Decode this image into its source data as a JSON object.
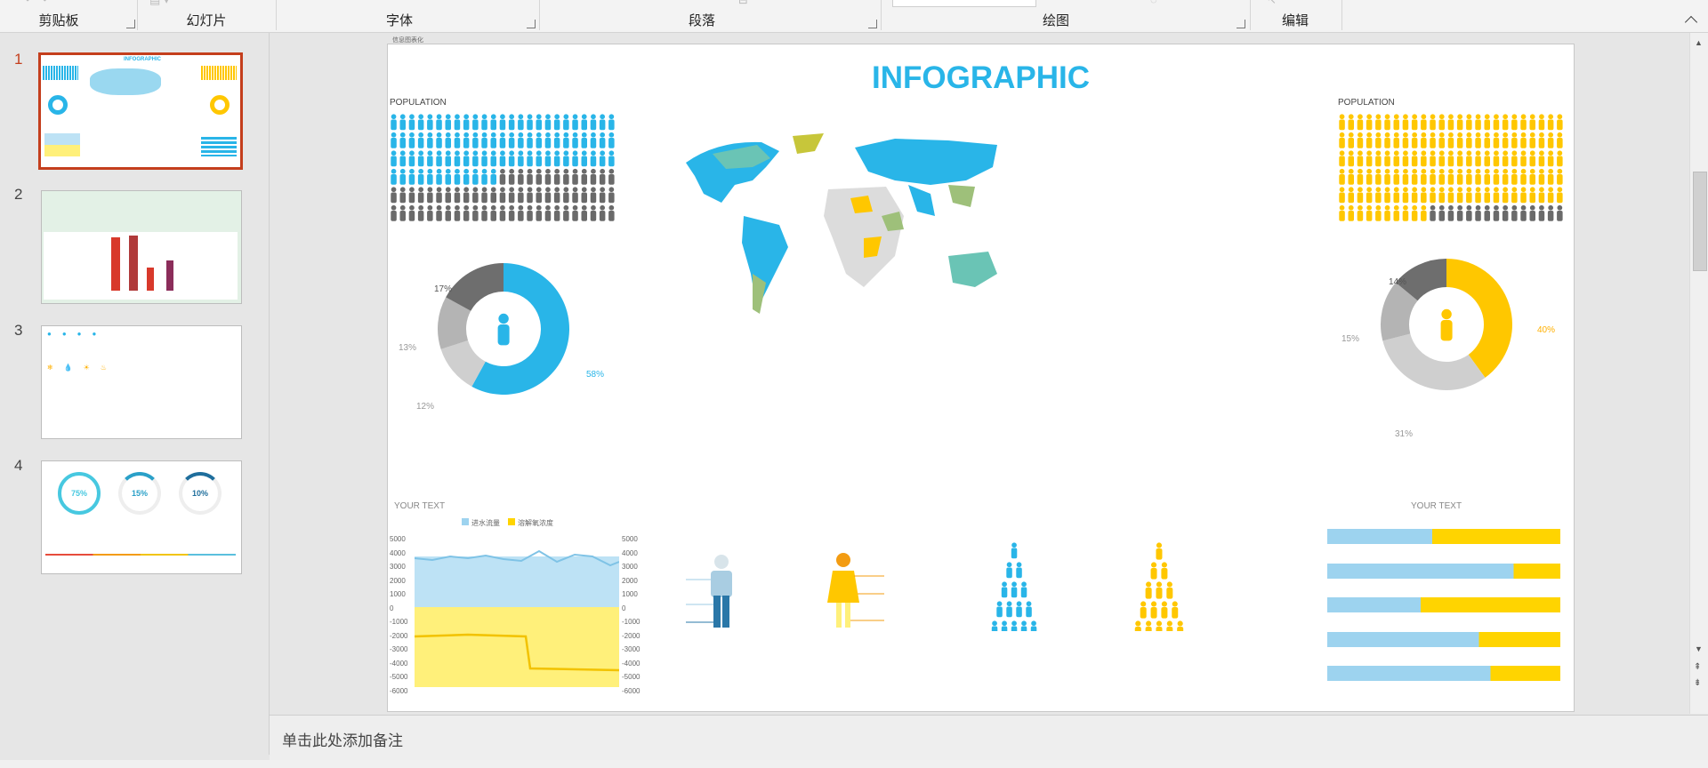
{
  "ribbon": {
    "groups": {
      "clipboard": "剪贴板",
      "slides": "幻灯片",
      "font": "字体",
      "paragraph": "段落",
      "drawing": "绘图",
      "editing": "编辑"
    }
  },
  "thumbnails": [
    {
      "number": "1",
      "selected": true,
      "title": "INFOGRAPHIC"
    },
    {
      "number": "2",
      "selected": false
    },
    {
      "number": "3",
      "selected": false
    },
    {
      "number": "4",
      "selected": false,
      "rings": [
        "75%",
        "15%",
        "10%"
      ]
    }
  ],
  "slide": {
    "note_label": "信息图表化",
    "title": "INFOGRAPHIC",
    "left_population_label": "POPULATION",
    "right_population_label": "POPULATION",
    "left_donut": {
      "labels": [
        "17%",
        "13%",
        "12%",
        "58%"
      ],
      "values": [
        17,
        13,
        12,
        58
      ],
      "colors": [
        "#6e6e6e",
        "#b4b4b4",
        "#cfcfcf",
        "#29b5e8"
      ]
    },
    "right_donut": {
      "labels": [
        "14%",
        "15%",
        "31%",
        "40%"
      ],
      "values": [
        14,
        15,
        31,
        40
      ],
      "colors": [
        "#6e6e6e",
        "#b4b4b4",
        "#cfcfcf",
        "#ffc700"
      ]
    },
    "bottom_left_title": "YOUR TEXT",
    "bottom_right_title": "YOUR TEXT",
    "legend": [
      "进水流量",
      "溶解氧浓度"
    ],
    "axis_ticks": [
      "5000",
      "4000",
      "3000",
      "2000",
      "1000",
      "0",
      "-1000",
      "-2000",
      "-3000",
      "-4000",
      "-5000",
      "-6000"
    ],
    "bar_splits": [
      0.45,
      0.8,
      0.4,
      0.65,
      0.7
    ]
  },
  "notes": {
    "placeholder": "单击此处添加备注"
  },
  "colors": {
    "accent": "#c43e1c",
    "blue": "#29b5e8",
    "yellow": "#ffd400",
    "light_blue": "#9dd3ef"
  }
}
